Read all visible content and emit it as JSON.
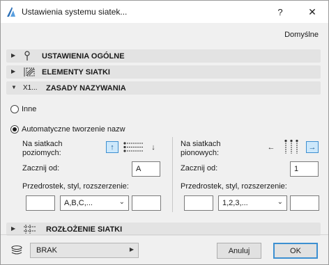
{
  "window": {
    "title": "Ustawienia systemu siatek...",
    "help": "?",
    "close": "✕"
  },
  "defaults_link": "Domyślne",
  "sections": {
    "general": {
      "label": "USTAWIENIA OGÓLNE",
      "arrow": "▶"
    },
    "elements": {
      "label": "ELEMENTY SIATKI",
      "arrow": "▶"
    },
    "naming": {
      "label": "ZASADY NAZYWANIA",
      "arrow": "▼",
      "icon_text": "X1..."
    },
    "layout": {
      "label": "ROZŁOŻENIE SIATKI",
      "arrow": "▶"
    }
  },
  "naming": {
    "option_other": "Inne",
    "option_auto": "Automatyczne tworzenie nazw",
    "selected_option": "auto",
    "horizontal": {
      "label_line1": "Na siatkach",
      "label_line2": "poziomych:",
      "start_label": "Zacznij od:",
      "start_value": "A",
      "prefix_label": "Przedrostek, styl, rozszerzenie:",
      "prefix_value": "",
      "style_value": "A,B,C,...",
      "suffix_value": "",
      "active_direction": "up",
      "arrow_up": "↑",
      "arrow_down": "↓"
    },
    "vertical": {
      "label_line1": "Na siatkach",
      "label_line2": "pionowych:",
      "start_label": "Zacznij od:",
      "start_value": "1",
      "prefix_label": "Przedrostek, styl, rozszerzenie:",
      "prefix_value": "",
      "style_value": "1,2,3,...",
      "suffix_value": "",
      "active_direction": "right",
      "arrow_left": "←",
      "arrow_right": "→"
    }
  },
  "footer": {
    "layer_value": "BRAK",
    "layer_arrow": "▶",
    "cancel_label": "Anuluj",
    "ok_label": "OK"
  },
  "colors": {
    "accent": "#3c8fd1",
    "active_button_fill": "#cde8fb",
    "section_header": "#e3e3e3",
    "dialog_bg": "#f0f0f0"
  },
  "icons": {
    "app": "archicad-logo-icon",
    "general": "pin-icon",
    "elements": "grid-element-icon",
    "naming": "naming-x1-icon",
    "layout": "grid-layout-icon",
    "layers": "layers-icon"
  }
}
